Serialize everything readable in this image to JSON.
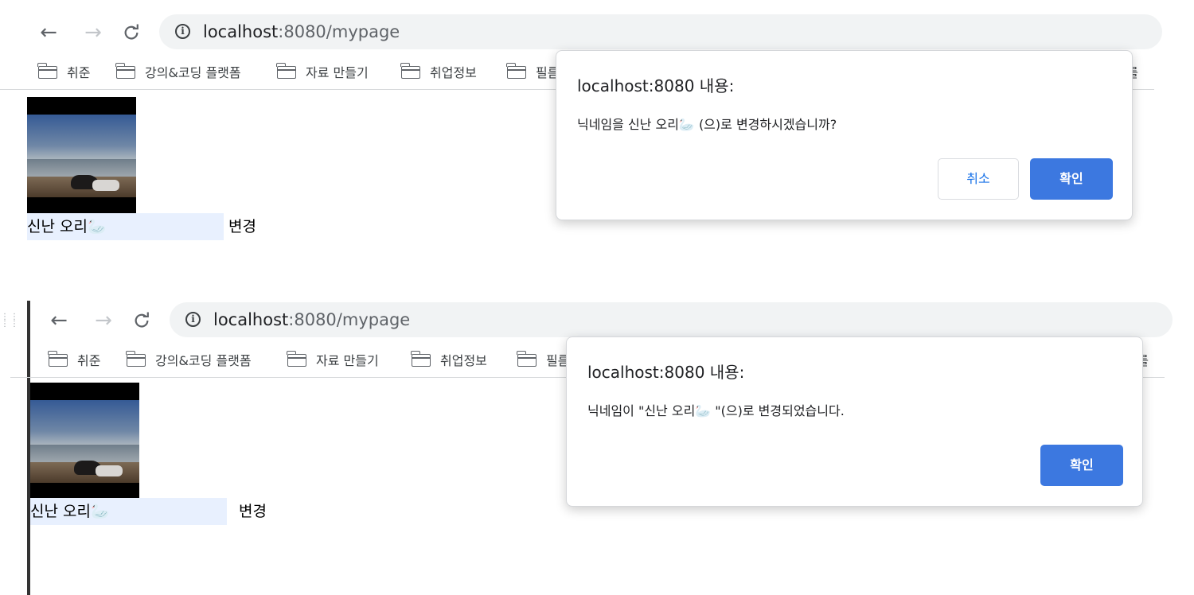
{
  "screenshots": [
    {
      "nav": {
        "back_icon": "←",
        "forward_icon": "→",
        "reload_icon": "C",
        "info_icon": "i"
      },
      "url": {
        "host": "localhost",
        "rest": ":8080/mypage"
      },
      "bookmarks": [
        {
          "label": "취준"
        },
        {
          "label": "강의&코딩 플랫폼"
        },
        {
          "label": "자료 만들기"
        },
        {
          "label": "취업정보"
        },
        {
          "label": "필름"
        }
      ],
      "bookmark_overflow": "를",
      "page": {
        "nickname_value": "신난 오리🦢",
        "change_label": "변경"
      },
      "dialog": {
        "title": "localhost:8080 내용:",
        "message": "닉네임을 신난 오리🦢 (으)로 변경하시겠습니까?",
        "cancel_label": "취소",
        "ok_label": "확인"
      }
    },
    {
      "nav": {
        "back_icon": "←",
        "forward_icon": "→",
        "reload_icon": "C",
        "info_icon": "i"
      },
      "url": {
        "host": "localhost",
        "rest": ":8080/mypage"
      },
      "bookmarks": [
        {
          "label": "취준"
        },
        {
          "label": "강의&코딩 플랫폼"
        },
        {
          "label": "자료 만들기"
        },
        {
          "label": "취업정보"
        },
        {
          "label": "필름"
        }
      ],
      "bookmark_overflow": "를",
      "page": {
        "nickname_value": "신난 오리🦢",
        "change_label": "변경"
      },
      "dialog": {
        "title": "localhost:8080 내용:",
        "message": "닉네임이 \"신난 오리🦢 \"(으)로 변경되었습니다.",
        "ok_label": "확인"
      }
    }
  ],
  "colors": {
    "accent": "#3c78e0",
    "link": "#1a73e8",
    "omnibox_bg": "#f1f3f4",
    "autofill_bg": "#e8f0fe"
  },
  "icons": {
    "folder": "folder-icon",
    "grip": "drag-handle-icon"
  }
}
